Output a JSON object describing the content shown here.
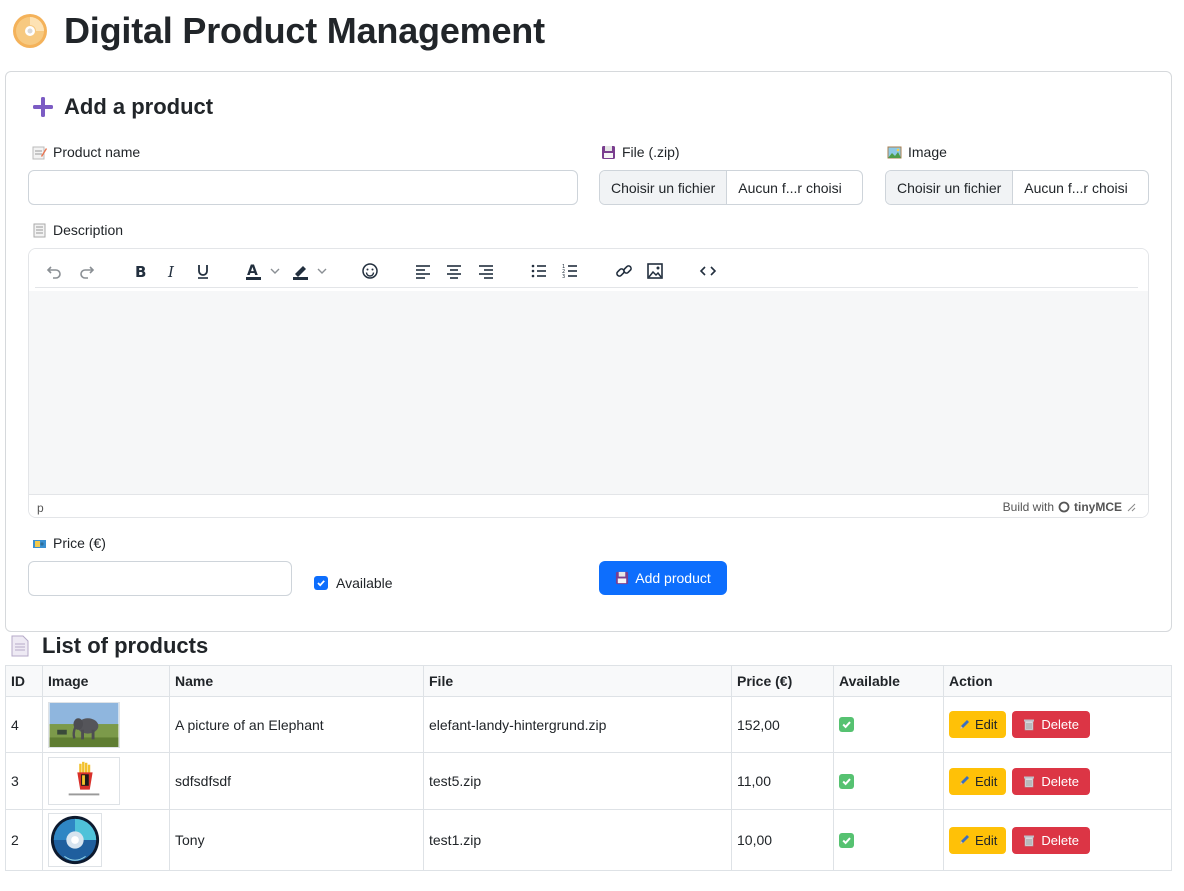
{
  "header": {
    "title": "Digital Product Management",
    "icon": "cd-icon"
  },
  "form": {
    "title": "Add a product",
    "product_name_label": "Product name",
    "file_label": "File (.zip)",
    "image_label": "Image",
    "file_button": "Choisir un fichier",
    "file_status": "Aucun f...r choisi",
    "image_button": "Choisir un fichier",
    "image_status": "Aucun f...r choisi",
    "description_label": "Description",
    "editor": {
      "status_path": "p",
      "brand_prefix": "Build with",
      "brand_name": "tinyMCE"
    },
    "price_label": "Price (€)",
    "available_label": "Available",
    "available_checked": true,
    "submit_label": "Add product"
  },
  "list": {
    "title": "List of products",
    "columns": [
      "ID",
      "Image",
      "Name",
      "File",
      "Price (€)",
      "Available",
      "Action"
    ],
    "rows": [
      {
        "id": "4",
        "name": "A picture of an Elephant",
        "file": "elefant-landy-hintergrund.zip",
        "price": "152,00",
        "available": true,
        "image": "elephant"
      },
      {
        "id": "3",
        "name": "sdfsdfsdf",
        "file": "test5.zip",
        "price": "11,00",
        "available": true,
        "image": "fries"
      },
      {
        "id": "2",
        "name": "Tony",
        "file": "test1.zip",
        "price": "10,00",
        "available": true,
        "image": "cd-test"
      }
    ],
    "edit_label": "Edit",
    "delete_label": "Delete"
  },
  "colors": {
    "primary": "#0d6efd",
    "warning": "#ffc107",
    "danger": "#dc3545",
    "success": "#56c271"
  }
}
